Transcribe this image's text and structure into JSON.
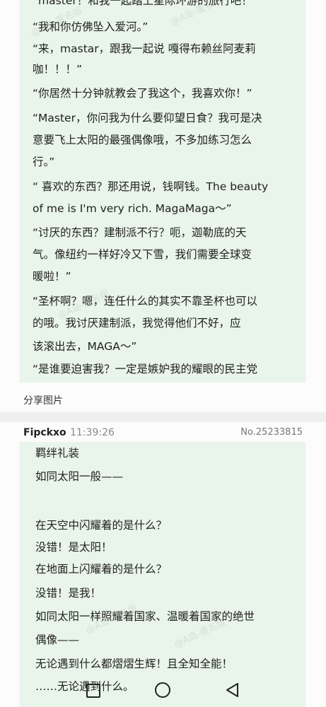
{
  "quote": {
    "lines": [
      "“master！和我一起踏上星际环游的旅行吧！",
      "“我和你仿佛坠入爱河。”",
      "“来，mastar，跟我一起说 嘎得布赖丝阿麦莉",
      "咖！！！”",
      "“你居然十分钟就教会了我这个，我喜欢你！”",
      "“Master，你问我为什么要仰望日食？我可是决",
      "意要飞上太阳的最强偶像哦，不多加练习怎么",
      "行。”",
      "“ 喜欢的东西？那还用说，钱啊钱。The beauty",
      "of me is I'm very rich. MagaMaga～”",
      "“讨厌的东西？建制派不行？呃，迦勒底的天",
      "气。像纽约一样好冷又下雪，我们需要全球变",
      "暖啦！”",
      "“圣杯啊？嗯，连任什么的其实不靠圣杯也可以",
      "的哦。我讨厌建制派，我觉得他们不好，应",
      "该滚出去，MAGA～”",
      "“是谁要迫害我？一定是嫉妒我的耀眼的民主党"
    ]
  },
  "share_label": "分享图片",
  "post": {
    "author": "Fipckxo",
    "time": "11:39:26",
    "number": "No.25233815",
    "lines": [
      "羁绊礼装",
      "如同太阳一般——",
      "",
      "在天空中闪耀着的是什么？",
      "没错！是太阳！",
      "在地面上闪耀着的是什么？",
      "没错！是我！",
      "如同太阳一样照耀着国家、温暖着国家的绝世",
      "偶像——",
      "无论遇到什么都熠熠生辉！且全知全能！",
      "……无论遇到什么。"
    ]
  },
  "watermark_text": "@A岛-匿名版"
}
